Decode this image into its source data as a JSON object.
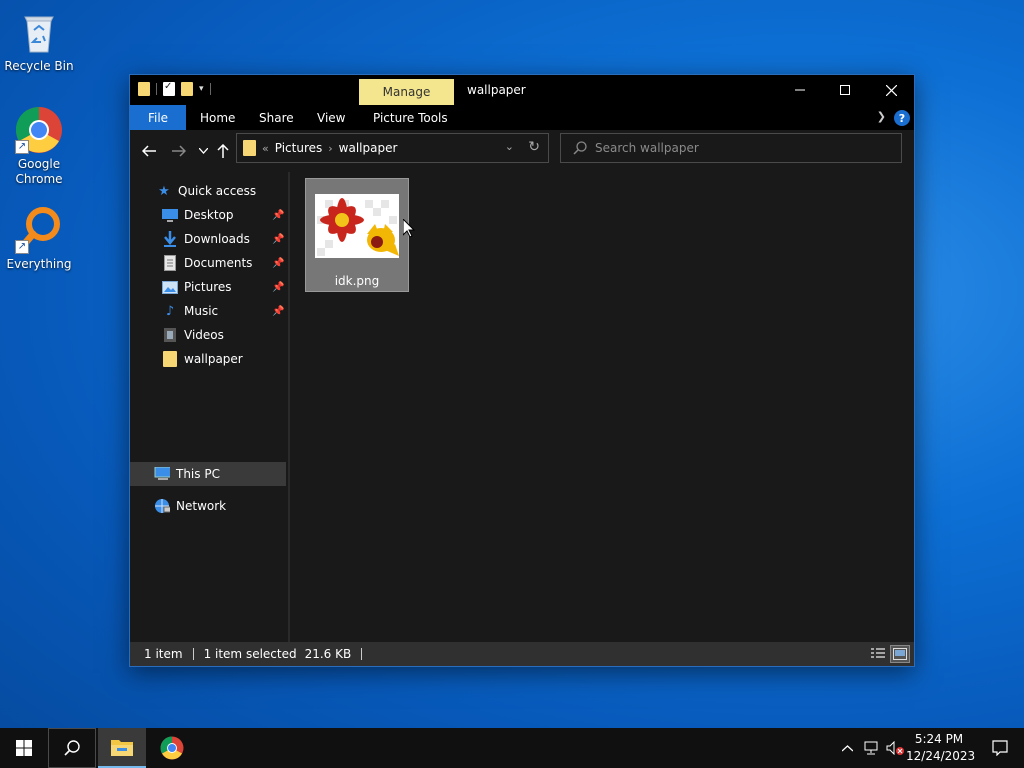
{
  "desktop": {
    "icons": [
      {
        "label": "Recycle Bin",
        "icon": "recycle-bin-icon"
      },
      {
        "label": "Google Chrome",
        "icon": "chrome-icon"
      },
      {
        "label": "Everything",
        "icon": "everything-search-icon"
      }
    ]
  },
  "explorer": {
    "title": "wallpaper",
    "contextual_tab": "Manage",
    "ribbon_tabs": [
      "File",
      "Home",
      "Share",
      "View",
      "Picture Tools"
    ],
    "breadcrumb": {
      "overflow": "«",
      "items": [
        "Pictures",
        "wallpaper"
      ]
    },
    "search_placeholder": "Search wallpaper",
    "sidebar": {
      "quick_access": "Quick access",
      "items": [
        {
          "label": "Desktop",
          "pinned": true,
          "icon": "desktop-icon"
        },
        {
          "label": "Downloads",
          "pinned": true,
          "icon": "downloads-icon"
        },
        {
          "label": "Documents",
          "pinned": true,
          "icon": "documents-icon"
        },
        {
          "label": "Pictures",
          "pinned": true,
          "icon": "pictures-icon"
        },
        {
          "label": "Music",
          "pinned": true,
          "icon": "music-icon"
        },
        {
          "label": "Videos",
          "pinned": false,
          "icon": "videos-icon"
        },
        {
          "label": "wallpaper",
          "pinned": false,
          "icon": "folder-icon"
        }
      ],
      "this_pc": "This PC",
      "network": "Network"
    },
    "files": [
      {
        "name": "idk.png",
        "selected": true
      }
    ],
    "status": {
      "count": "1 item",
      "selection": "1 item selected",
      "size": "21.6 KB"
    }
  },
  "taskbar": {
    "time": "5:24 PM",
    "date": "12/24/2023",
    "pinned": [
      "File Explorer",
      "Google Chrome"
    ]
  },
  "colors": {
    "accent": "#1a6ed0",
    "manage_tab": "#f4e68e",
    "folder": "#f7d774"
  }
}
